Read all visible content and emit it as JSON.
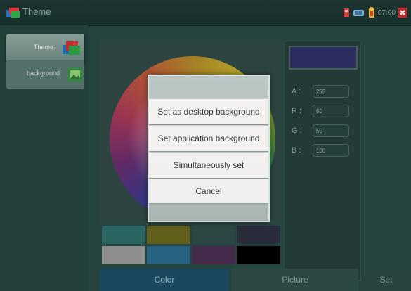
{
  "app": {
    "title": "Theme"
  },
  "status_bar": {
    "time": "07:00"
  },
  "sidebar": {
    "items": [
      {
        "label": "Theme",
        "selected": true
      },
      {
        "label": "background",
        "selected": false
      }
    ]
  },
  "color_values": {
    "a_label": "A :",
    "a_value": "255",
    "r_label": "R :",
    "r_value": "50",
    "g_label": "G :",
    "g_value": "50",
    "b_label": "B :",
    "b_value": "100",
    "preview_color": "#313066"
  },
  "palette": [
    "#2e6e6a",
    "#6b661f",
    "#2f4c4a",
    "#2c2f3f",
    "#9a9a9a",
    "#2b6c8d",
    "#4a2f53",
    "#000000"
  ],
  "tabs": {
    "color": "Color",
    "picture": "Picture",
    "set": "Set"
  },
  "dialog": {
    "options": [
      "Set as desktop background",
      "Set application background",
      "Simultaneously set",
      "Cancel"
    ]
  }
}
